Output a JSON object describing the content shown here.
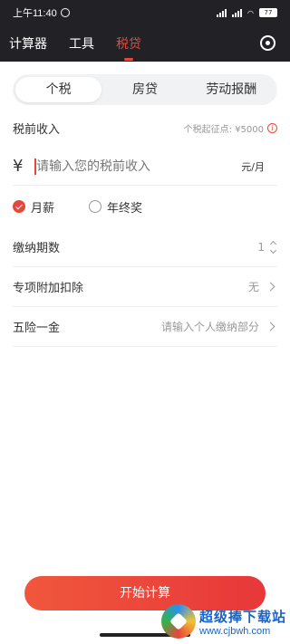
{
  "status_bar": {
    "time": "上午11:40",
    "battery": "77"
  },
  "nav": {
    "tabs": [
      {
        "label": "计算器"
      },
      {
        "label": "工具"
      },
      {
        "label": "税贷"
      }
    ],
    "active_tab": "税贷"
  },
  "segment": {
    "items": [
      {
        "label": "个税"
      },
      {
        "label": "房贷"
      },
      {
        "label": "劳动报酬"
      }
    ],
    "active": "个税"
  },
  "income": {
    "label": "税前收入",
    "threshold": "个税起征点: ¥5000",
    "currency_symbol": "¥",
    "placeholder": "请输入您的税前收入",
    "unit": "元/月"
  },
  "salary_type": {
    "options": [
      {
        "label": "月薪",
        "checked": true
      },
      {
        "label": "年终奖",
        "checked": false
      }
    ]
  },
  "fields": {
    "periods": {
      "label": "缴纳期数",
      "value": "1"
    },
    "special_deduction": {
      "label": "专项附加扣除",
      "value": "无"
    },
    "insurance": {
      "label": "五险一金",
      "value": "请输入个人缴纳部分"
    }
  },
  "start_button": {
    "label": "开始计算"
  },
  "watermark": {
    "title": "超级捧下载站",
    "url": "www.cjbwh.com"
  },
  "colors": {
    "accent": "#e8463a",
    "nav_bg": "#222226"
  }
}
